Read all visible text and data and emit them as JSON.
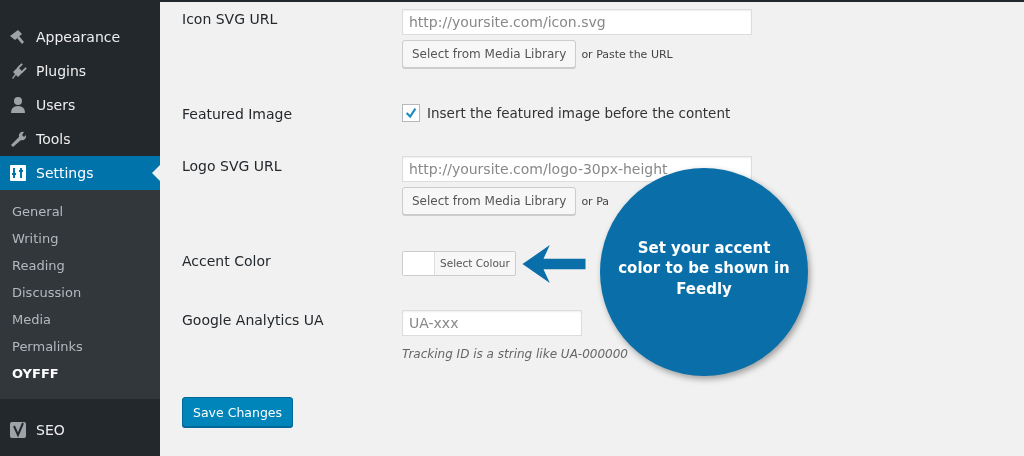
{
  "sidebar": {
    "items": [
      {
        "label": "Appearance",
        "selected": false
      },
      {
        "label": "Plugins",
        "selected": false
      },
      {
        "label": "Users",
        "selected": false
      },
      {
        "label": "Tools",
        "selected": false
      },
      {
        "label": "Settings",
        "selected": true
      }
    ],
    "submenu": [
      {
        "label": "General",
        "selected": false
      },
      {
        "label": "Writing",
        "selected": false
      },
      {
        "label": "Reading",
        "selected": false
      },
      {
        "label": "Discussion",
        "selected": false
      },
      {
        "label": "Media",
        "selected": false
      },
      {
        "label": "Permalinks",
        "selected": false
      },
      {
        "label": "OYFFF",
        "selected": true
      }
    ],
    "after": [
      {
        "label": "SEO",
        "selected": false
      }
    ]
  },
  "form": {
    "icon_url": {
      "label": "Icon SVG URL",
      "placeholder": "http://yoursite.com/icon.svg",
      "button": "Select from Media Library",
      "note": "or Paste the URL"
    },
    "featured": {
      "label": "Featured Image",
      "checked": true,
      "text": "Insert the featured image before the content"
    },
    "logo_url": {
      "label": "Logo SVG URL",
      "placeholder": "http://yoursite.com/logo-30px-height",
      "button": "Select from Media Library",
      "note": "or Pa"
    },
    "accent": {
      "label": "Accent Color",
      "button": "Select Colour"
    },
    "analytics": {
      "label": "Google Analytics UA",
      "placeholder": "UA-xxx",
      "description": "Tracking ID is a string like UA-000000"
    },
    "save": "Save Changes"
  },
  "callout": {
    "text": "Set your accent color to be shown in Feedly"
  }
}
